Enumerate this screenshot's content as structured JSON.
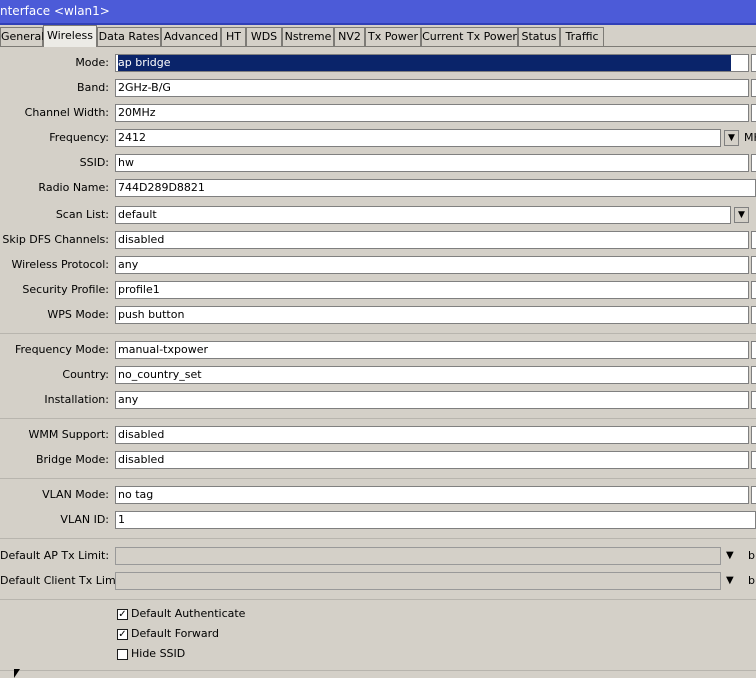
{
  "window": {
    "title": "nterface <wlan1>"
  },
  "tabs": [
    "General",
    "Wireless",
    "Data Rates",
    "Advanced",
    "HT",
    "WDS",
    "Nstreme",
    "NV2",
    "Tx Power",
    "Current Tx Power",
    "Status",
    "Traffic"
  ],
  "active_tab": "Wireless",
  "fields": {
    "mode": {
      "label": "Mode:",
      "value": "ap bridge"
    },
    "band": {
      "label": "Band:",
      "value": "2GHz-B/G"
    },
    "channel_width": {
      "label": "Channel Width:",
      "value": "20MHz"
    },
    "frequency": {
      "label": "Frequency:",
      "value": "2412",
      "unit": "MH"
    },
    "ssid": {
      "label": "SSID:",
      "value": "hw"
    },
    "radio_name": {
      "label": "Radio Name:",
      "value": "744D289D8821"
    },
    "scan_list": {
      "label": "Scan List:",
      "value": "default"
    },
    "skip_dfs": {
      "label": "Skip DFS Channels:",
      "value": "disabled"
    },
    "wireless_protocol": {
      "label": "Wireless Protocol:",
      "value": "any"
    },
    "security_profile": {
      "label": "Security Profile:",
      "value": "profile1"
    },
    "wps_mode": {
      "label": "WPS Mode:",
      "value": "push button"
    },
    "frequency_mode": {
      "label": "Frequency Mode:",
      "value": "manual-txpower"
    },
    "country": {
      "label": "Country:",
      "value": "no_country_set"
    },
    "installation": {
      "label": "Installation:",
      "value": "any"
    },
    "wmm_support": {
      "label": "WMM Support:",
      "value": "disabled"
    },
    "bridge_mode": {
      "label": "Bridge Mode:",
      "value": "disabled"
    },
    "vlan_mode": {
      "label": "VLAN Mode:",
      "value": "no tag"
    },
    "vlan_id": {
      "label": "VLAN ID:",
      "value": "1"
    },
    "default_ap_tx_limit": {
      "label": "Default AP Tx Limit:",
      "value": "",
      "unit": "b"
    },
    "default_client_tx_limit": {
      "label": "Default Client Tx Limit:",
      "value": "",
      "unit": "b"
    }
  },
  "checkboxes": {
    "default_authenticate": {
      "label": "Default Authenticate",
      "checked": true,
      "mark": "✓"
    },
    "default_forward": {
      "label": "Default Forward",
      "checked": true,
      "mark": "✓"
    },
    "hide_ssid": {
      "label": "Hide SSID",
      "checked": false,
      "mark": ""
    }
  },
  "icons": {
    "dropdown": "dropdown-arrow-icon",
    "expand": "expand-arrow-icon"
  }
}
